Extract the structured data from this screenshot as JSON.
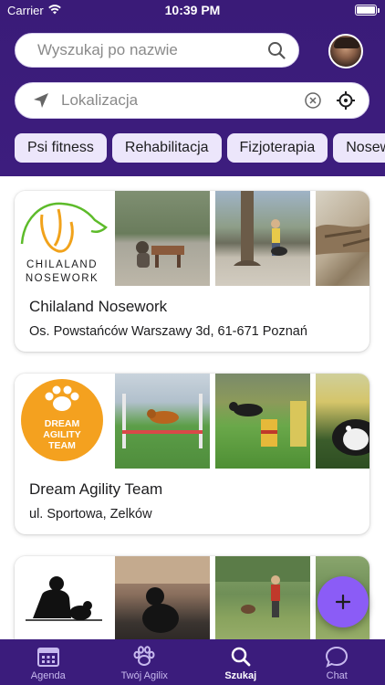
{
  "status_bar": {
    "carrier": "Carrier",
    "time": "10:39 PM"
  },
  "search": {
    "placeholder": "Wyszukaj po nazwie"
  },
  "location": {
    "placeholder": "Lokalizacja"
  },
  "categories": [
    "Psi fitness",
    "Rehabilitacja",
    "Fizjoterapia",
    "Nosew"
  ],
  "places": [
    {
      "name": "Chilaland Nosework",
      "address": "Os. Powstańców Warszawy 3d, 61-671 Poznań",
      "logo_text": [
        "CHILALAND",
        "NOSEWORK"
      ]
    },
    {
      "name": "Dream Agility Team",
      "address": "ul. Sportowa, Zelków",
      "logo_text": [
        "DREAM",
        "AGILITY",
        "TEAM"
      ]
    },
    {
      "name": "",
      "address": ""
    }
  ],
  "tabs": [
    {
      "label": "Agenda",
      "icon": "calendar-icon"
    },
    {
      "label": "Twój Agilix",
      "icon": "paw-icon"
    },
    {
      "label": "Szukaj",
      "icon": "search-icon",
      "active": true
    },
    {
      "label": "Chat",
      "icon": "chat-icon"
    }
  ],
  "colors": {
    "header": "#3a1b78",
    "accent": "#8b5cf6",
    "chip_bg": "#ece6fb",
    "tabbar": "#3b1c7c"
  }
}
